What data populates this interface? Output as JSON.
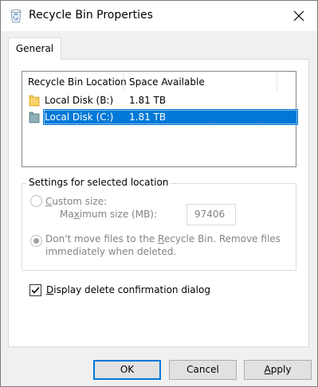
{
  "window": {
    "title": "Recycle Bin Properties",
    "icon": "recycle-bin-icon",
    "close_icon": "close-icon"
  },
  "tabs": [
    {
      "label": "General",
      "selected": true
    }
  ],
  "locations_list": {
    "columns": [
      "Recycle Bin Location",
      "Space Available"
    ],
    "rows": [
      {
        "location": "Local Disk (B:)",
        "space": "1.81 TB",
        "icon": "folder-icon",
        "selected": false
      },
      {
        "location": "Local Disk (C:)",
        "space": "1.81 TB",
        "icon": "folder-icon",
        "selected": true
      }
    ]
  },
  "settings": {
    "group_label": "Settings for selected location",
    "custom_size_label_a": "C",
    "custom_size_label_b": "ustom size:",
    "max_size_label_a": "Ma",
    "max_size_label_b": "x",
    "max_size_label_c": "imum size (MB):",
    "max_size_value": "97406",
    "dont_move_line1_a": "Don't move files to the ",
    "dont_move_line1_b": "R",
    "dont_move_line1_c": "ecycle Bin. Remove files",
    "dont_move_line2": "immediately when deleted.",
    "custom_size_selected": false,
    "dont_move_selected": true,
    "disabled": true
  },
  "confirmation": {
    "label_a": "D",
    "label_b": "isplay delete confirmation dialog",
    "checked": true
  },
  "buttons": {
    "ok": "OK",
    "cancel": "Cancel",
    "apply_a": "A",
    "apply_b": "pply"
  },
  "colors": {
    "selection": "#0078d7",
    "folder": "#f1c54b",
    "disabled_text": "#838383"
  }
}
